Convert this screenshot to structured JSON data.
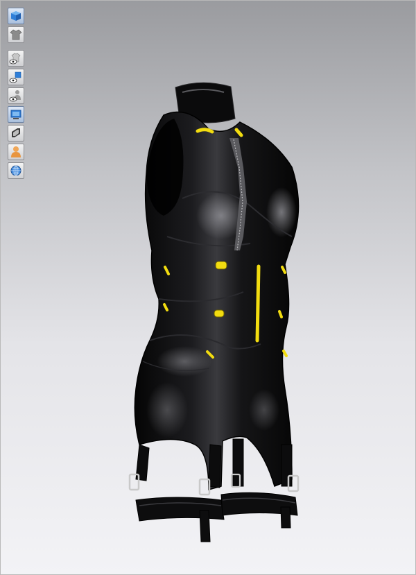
{
  "window": {
    "title": ""
  },
  "toolbar": {
    "tools": [
      {
        "id": "view-3d",
        "icon": "3d-cube-icon",
        "accent": "#2f7fd8"
      },
      {
        "id": "garment",
        "icon": "shirt-icon",
        "accent": "#7d7d7d"
      },
      {
        "id": "show-garment",
        "icon": "eye-shirt-icon",
        "accent": "#7d7d7d"
      },
      {
        "id": "show-pattern",
        "icon": "eye-pattern-icon",
        "accent": "#2f7fd8"
      },
      {
        "id": "show-avatar",
        "icon": "eye-avatar-icon",
        "accent": "#7d7d7d"
      },
      {
        "id": "texture-mode",
        "icon": "texture-display-icon",
        "accent": "#2f7fd8"
      },
      {
        "id": "shading-mode",
        "icon": "shading-icon",
        "accent": "#555555"
      },
      {
        "id": "avatar",
        "icon": "avatar-icon",
        "accent": "#e8953f"
      },
      {
        "id": "world",
        "icon": "globe-icon",
        "accent": "#2f7fd8"
      }
    ]
  },
  "scene": {
    "background_top": "#9a9b9f",
    "background_bottom": "#f3f3f6",
    "garment_color": "#0b0b0c",
    "trim_color": "#f2dc10",
    "hardware_color": "#c9c9c9"
  }
}
